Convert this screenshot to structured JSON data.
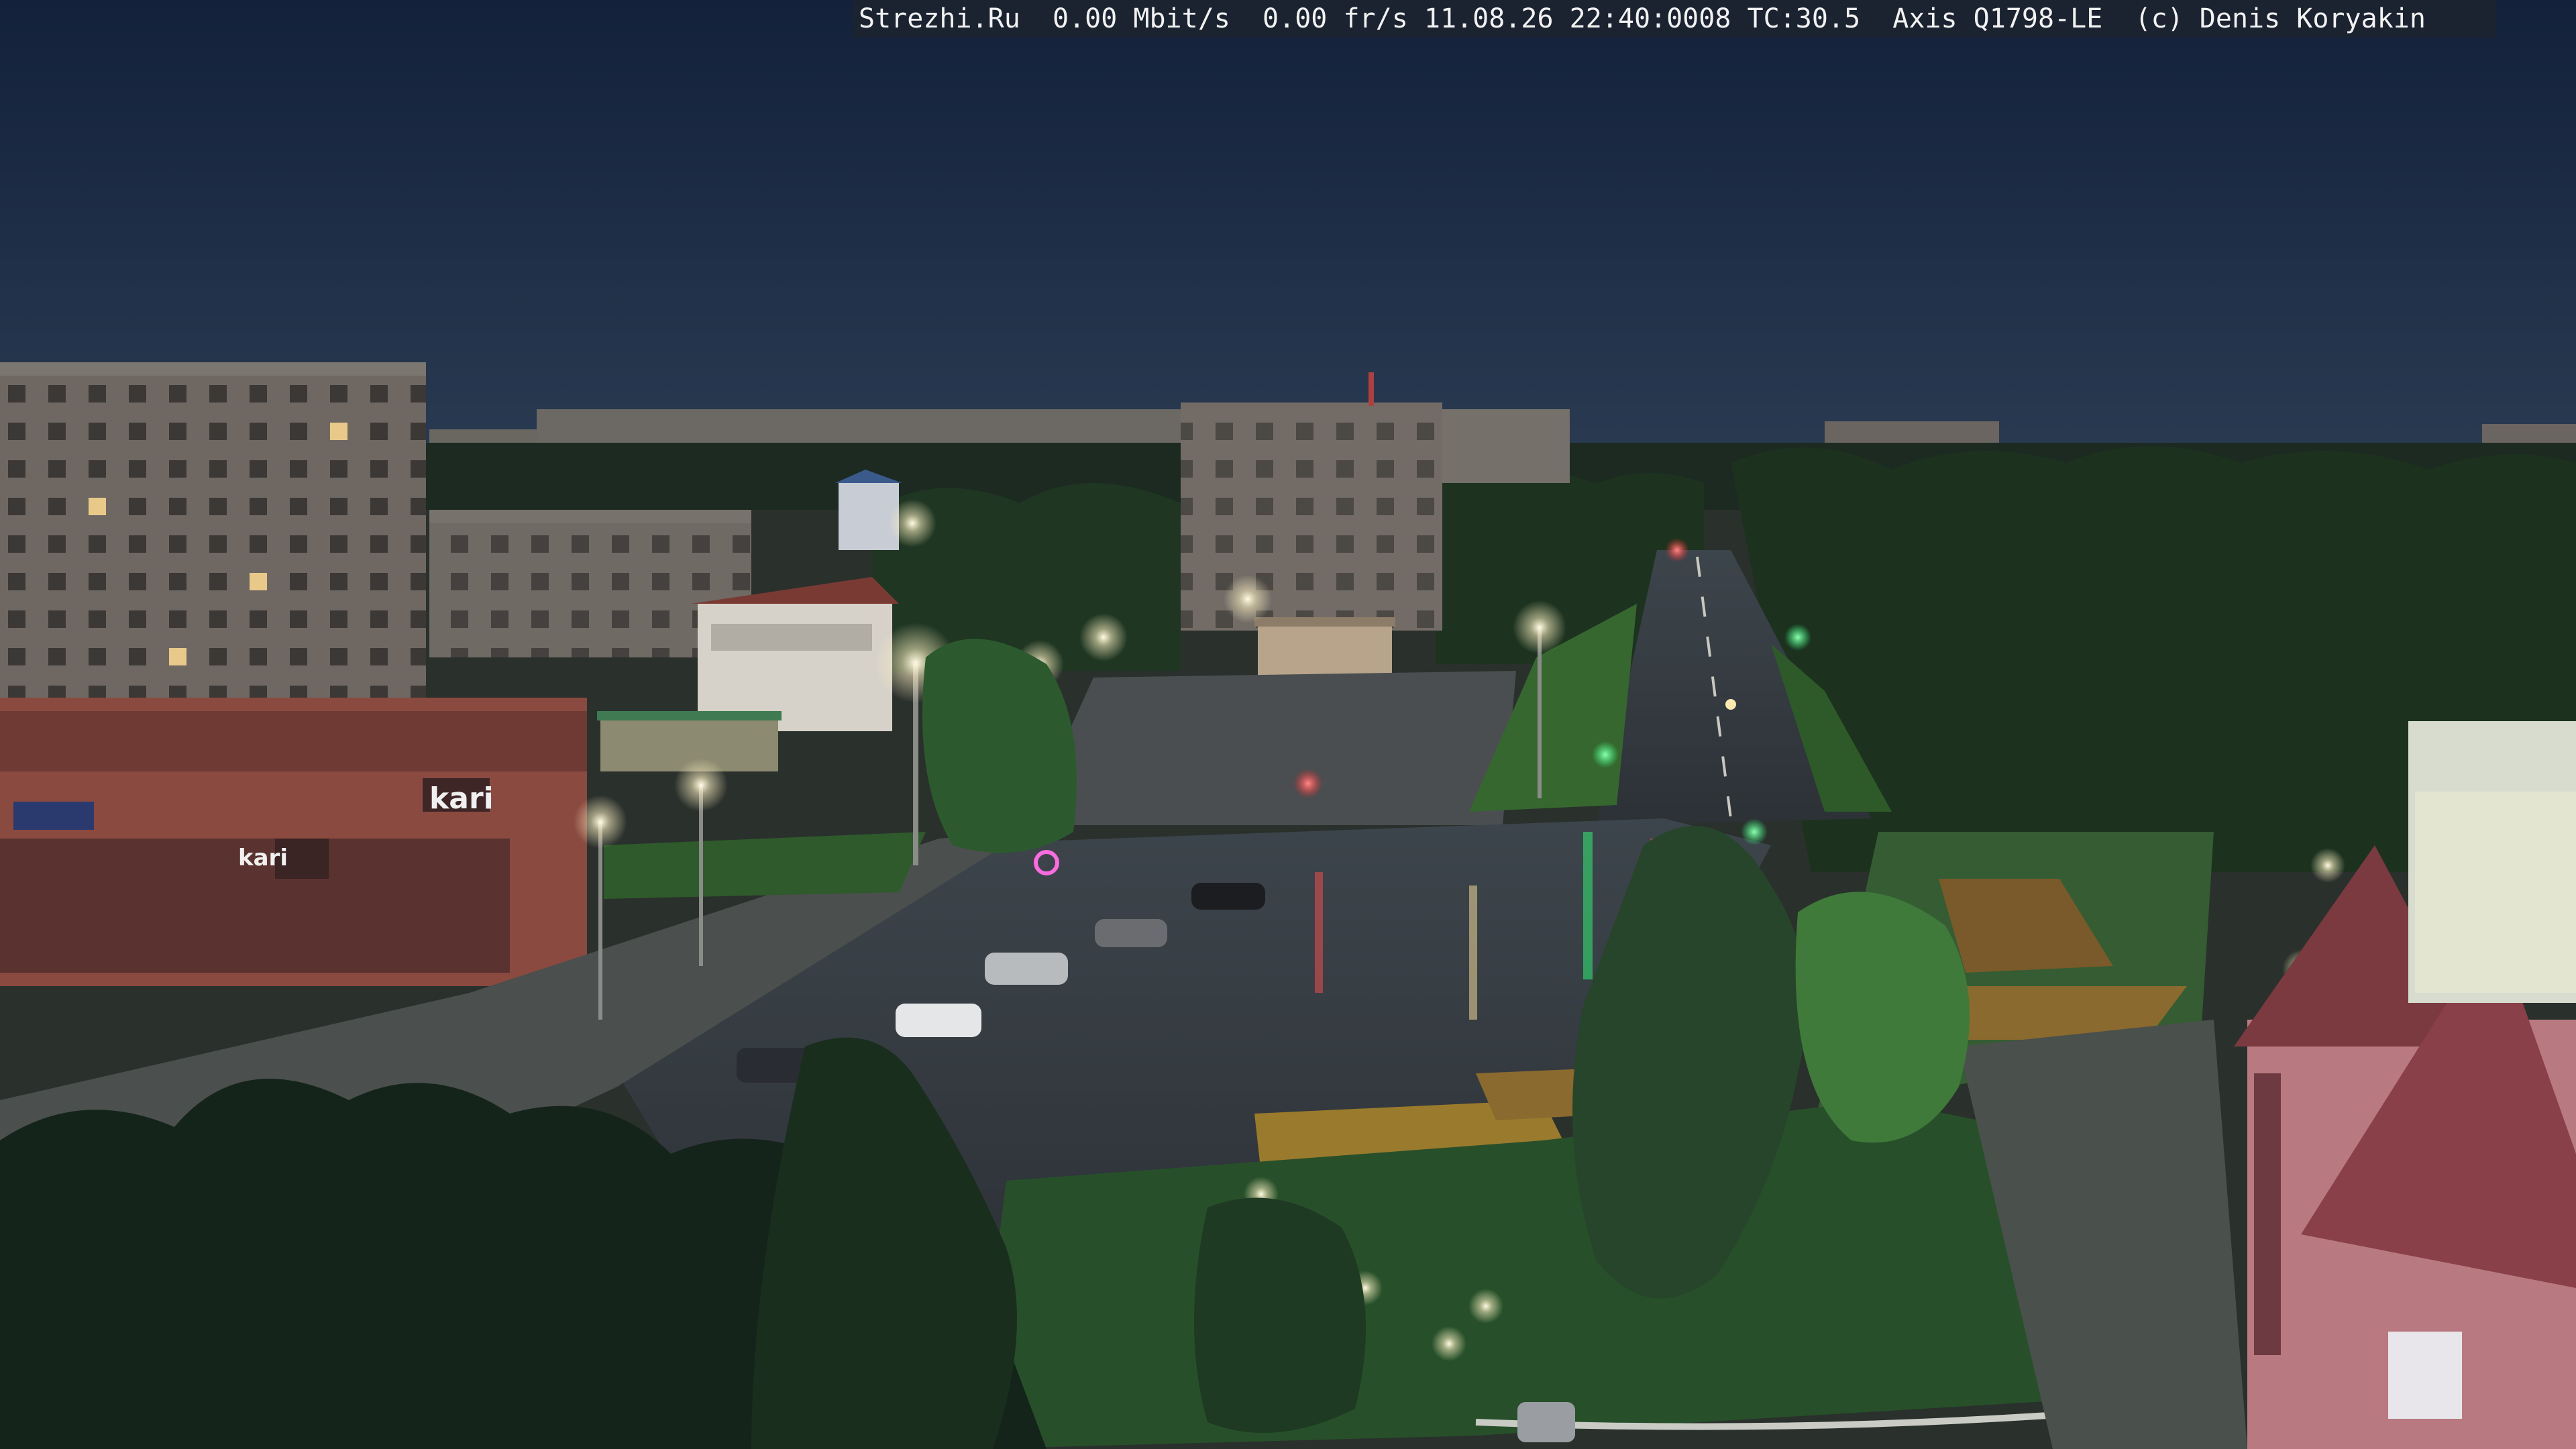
{
  "overlay": {
    "text": "Strezhi.Ru  0.00 Mbit/s  0.00 fr/s 11.08.26 22:40:0008 TC:30.5  Axis Q1798-LE  (c) Denis Koryakin"
  },
  "signs": {
    "store_sign": "kari",
    "store_sign_small": "kari"
  },
  "colors": {
    "sky_top": "#14223a",
    "sky_bottom": "#26374f",
    "trees": "#1d3320",
    "road": "#3a3f44",
    "streetlight": "#fff6d8",
    "traffic_green": "#2dff7a",
    "traffic_red": "#ff3030",
    "building_brick": "#8a4a40"
  }
}
